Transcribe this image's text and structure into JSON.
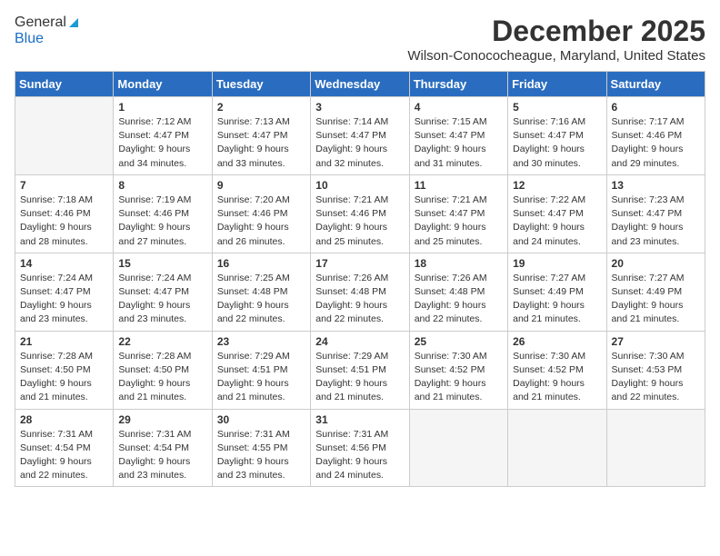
{
  "header": {
    "logo_general": "General",
    "logo_blue": "Blue",
    "month_title": "December 2025",
    "location": "Wilson-Conococheague, Maryland, United States"
  },
  "weekdays": [
    "Sunday",
    "Monday",
    "Tuesday",
    "Wednesday",
    "Thursday",
    "Friday",
    "Saturday"
  ],
  "weeks": [
    [
      {
        "day": "",
        "sunrise": "",
        "sunset": "",
        "daylight": "",
        "empty": true
      },
      {
        "day": "1",
        "sunrise": "Sunrise: 7:12 AM",
        "sunset": "Sunset: 4:47 PM",
        "daylight": "Daylight: 9 hours and 34 minutes."
      },
      {
        "day": "2",
        "sunrise": "Sunrise: 7:13 AM",
        "sunset": "Sunset: 4:47 PM",
        "daylight": "Daylight: 9 hours and 33 minutes."
      },
      {
        "day": "3",
        "sunrise": "Sunrise: 7:14 AM",
        "sunset": "Sunset: 4:47 PM",
        "daylight": "Daylight: 9 hours and 32 minutes."
      },
      {
        "day": "4",
        "sunrise": "Sunrise: 7:15 AM",
        "sunset": "Sunset: 4:47 PM",
        "daylight": "Daylight: 9 hours and 31 minutes."
      },
      {
        "day": "5",
        "sunrise": "Sunrise: 7:16 AM",
        "sunset": "Sunset: 4:47 PM",
        "daylight": "Daylight: 9 hours and 30 minutes."
      },
      {
        "day": "6",
        "sunrise": "Sunrise: 7:17 AM",
        "sunset": "Sunset: 4:46 PM",
        "daylight": "Daylight: 9 hours and 29 minutes."
      }
    ],
    [
      {
        "day": "7",
        "sunrise": "Sunrise: 7:18 AM",
        "sunset": "Sunset: 4:46 PM",
        "daylight": "Daylight: 9 hours and 28 minutes."
      },
      {
        "day": "8",
        "sunrise": "Sunrise: 7:19 AM",
        "sunset": "Sunset: 4:46 PM",
        "daylight": "Daylight: 9 hours and 27 minutes."
      },
      {
        "day": "9",
        "sunrise": "Sunrise: 7:20 AM",
        "sunset": "Sunset: 4:46 PM",
        "daylight": "Daylight: 9 hours and 26 minutes."
      },
      {
        "day": "10",
        "sunrise": "Sunrise: 7:21 AM",
        "sunset": "Sunset: 4:46 PM",
        "daylight": "Daylight: 9 hours and 25 minutes."
      },
      {
        "day": "11",
        "sunrise": "Sunrise: 7:21 AM",
        "sunset": "Sunset: 4:47 PM",
        "daylight": "Daylight: 9 hours and 25 minutes."
      },
      {
        "day": "12",
        "sunrise": "Sunrise: 7:22 AM",
        "sunset": "Sunset: 4:47 PM",
        "daylight": "Daylight: 9 hours and 24 minutes."
      },
      {
        "day": "13",
        "sunrise": "Sunrise: 7:23 AM",
        "sunset": "Sunset: 4:47 PM",
        "daylight": "Daylight: 9 hours and 23 minutes."
      }
    ],
    [
      {
        "day": "14",
        "sunrise": "Sunrise: 7:24 AM",
        "sunset": "Sunset: 4:47 PM",
        "daylight": "Daylight: 9 hours and 23 minutes."
      },
      {
        "day": "15",
        "sunrise": "Sunrise: 7:24 AM",
        "sunset": "Sunset: 4:47 PM",
        "daylight": "Daylight: 9 hours and 23 minutes."
      },
      {
        "day": "16",
        "sunrise": "Sunrise: 7:25 AM",
        "sunset": "Sunset: 4:48 PM",
        "daylight": "Daylight: 9 hours and 22 minutes."
      },
      {
        "day": "17",
        "sunrise": "Sunrise: 7:26 AM",
        "sunset": "Sunset: 4:48 PM",
        "daylight": "Daylight: 9 hours and 22 minutes."
      },
      {
        "day": "18",
        "sunrise": "Sunrise: 7:26 AM",
        "sunset": "Sunset: 4:48 PM",
        "daylight": "Daylight: 9 hours and 22 minutes."
      },
      {
        "day": "19",
        "sunrise": "Sunrise: 7:27 AM",
        "sunset": "Sunset: 4:49 PM",
        "daylight": "Daylight: 9 hours and 21 minutes."
      },
      {
        "day": "20",
        "sunrise": "Sunrise: 7:27 AM",
        "sunset": "Sunset: 4:49 PM",
        "daylight": "Daylight: 9 hours and 21 minutes."
      }
    ],
    [
      {
        "day": "21",
        "sunrise": "Sunrise: 7:28 AM",
        "sunset": "Sunset: 4:50 PM",
        "daylight": "Daylight: 9 hours and 21 minutes."
      },
      {
        "day": "22",
        "sunrise": "Sunrise: 7:28 AM",
        "sunset": "Sunset: 4:50 PM",
        "daylight": "Daylight: 9 hours and 21 minutes."
      },
      {
        "day": "23",
        "sunrise": "Sunrise: 7:29 AM",
        "sunset": "Sunset: 4:51 PM",
        "daylight": "Daylight: 9 hours and 21 minutes."
      },
      {
        "day": "24",
        "sunrise": "Sunrise: 7:29 AM",
        "sunset": "Sunset: 4:51 PM",
        "daylight": "Daylight: 9 hours and 21 minutes."
      },
      {
        "day": "25",
        "sunrise": "Sunrise: 7:30 AM",
        "sunset": "Sunset: 4:52 PM",
        "daylight": "Daylight: 9 hours and 21 minutes."
      },
      {
        "day": "26",
        "sunrise": "Sunrise: 7:30 AM",
        "sunset": "Sunset: 4:52 PM",
        "daylight": "Daylight: 9 hours and 21 minutes."
      },
      {
        "day": "27",
        "sunrise": "Sunrise: 7:30 AM",
        "sunset": "Sunset: 4:53 PM",
        "daylight": "Daylight: 9 hours and 22 minutes."
      }
    ],
    [
      {
        "day": "28",
        "sunrise": "Sunrise: 7:31 AM",
        "sunset": "Sunset: 4:54 PM",
        "daylight": "Daylight: 9 hours and 22 minutes."
      },
      {
        "day": "29",
        "sunrise": "Sunrise: 7:31 AM",
        "sunset": "Sunset: 4:54 PM",
        "daylight": "Daylight: 9 hours and 23 minutes."
      },
      {
        "day": "30",
        "sunrise": "Sunrise: 7:31 AM",
        "sunset": "Sunset: 4:55 PM",
        "daylight": "Daylight: 9 hours and 23 minutes."
      },
      {
        "day": "31",
        "sunrise": "Sunrise: 7:31 AM",
        "sunset": "Sunset: 4:56 PM",
        "daylight": "Daylight: 9 hours and 24 minutes."
      },
      {
        "day": "",
        "sunrise": "",
        "sunset": "",
        "daylight": "",
        "empty": true
      },
      {
        "day": "",
        "sunrise": "",
        "sunset": "",
        "daylight": "",
        "empty": true
      },
      {
        "day": "",
        "sunrise": "",
        "sunset": "",
        "daylight": "",
        "empty": true
      }
    ]
  ]
}
